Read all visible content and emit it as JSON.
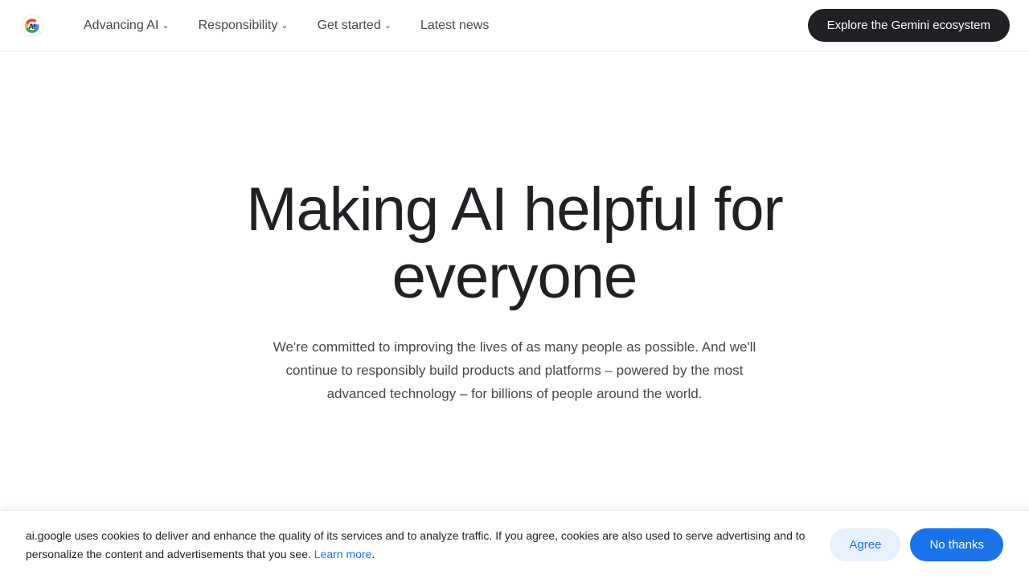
{
  "nav": {
    "logo_text": "Google AI",
    "links": [
      {
        "label": "Advancing AI",
        "has_dropdown": true
      },
      {
        "label": "Responsibility",
        "has_dropdown": true
      },
      {
        "label": "Get started",
        "has_dropdown": true
      },
      {
        "label": "Latest news",
        "has_dropdown": false
      }
    ],
    "cta_label": "Explore the Gemini ecosystem"
  },
  "hero": {
    "title": "Making AI helpful for everyone",
    "subtitle": "We're committed to improving the lives of as many people as possible. And we'll continue to responsibly build products and platforms – powered by the most advanced technology – for billions of people around the world."
  },
  "cookie": {
    "message": "ai.google uses cookies to deliver and enhance the quality of its services and to analyze traffic. If you agree, cookies are also used to serve advertising and to personalize the content and advertisements that you see.",
    "learn_more_label": "Learn more",
    "agree_label": "Agree",
    "no_thanks_label": "No thanks"
  }
}
